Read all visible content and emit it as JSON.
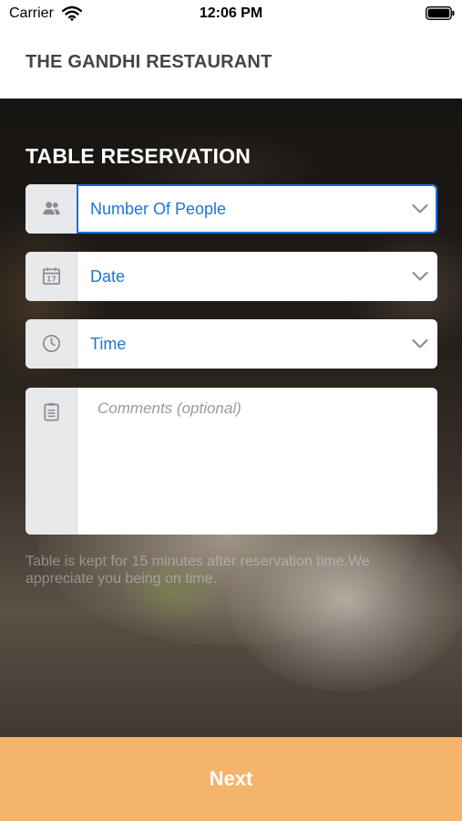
{
  "status_bar": {
    "carrier": "Carrier",
    "time": "12:06 PM"
  },
  "header": {
    "title": "THE GANDHI RESTAURANT"
  },
  "form": {
    "title": "TABLE RESERVATION",
    "fields": [
      {
        "label": "Number Of People",
        "icon": "people-icon",
        "type": "dropdown",
        "focused": true
      },
      {
        "label": "Date",
        "icon": "calendar-icon",
        "type": "dropdown"
      },
      {
        "label": "Time",
        "icon": "clock-icon",
        "type": "dropdown"
      }
    ],
    "comments_placeholder": "Comments (optional)",
    "notice": "Table is kept for 15 minutes after reservation time.We appreciate you being on time."
  },
  "footer": {
    "next_label": "Next"
  },
  "colors": {
    "accent_blue": "#1f76d2",
    "button_orange": "#f4b46a",
    "title_gray": "#444444"
  }
}
